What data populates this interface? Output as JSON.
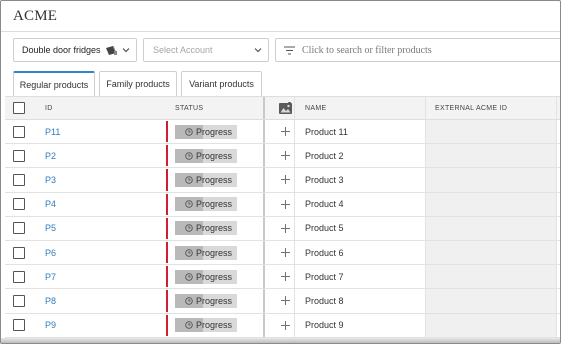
{
  "app": {
    "title": "ACME"
  },
  "toolbar": {
    "catalog_label": "Double door fridges",
    "account_placeholder": "Select Account",
    "search_placeholder": "Click to search or filter products"
  },
  "tabs": [
    {
      "label": "Regular products",
      "active": true
    },
    {
      "label": "Family products",
      "active": false
    },
    {
      "label": "Variant products",
      "active": false
    }
  ],
  "table": {
    "columns": {
      "id": "ID",
      "status": "STATUS",
      "name": "NAME",
      "external_id": "EXTERNAL ACME ID"
    },
    "rows": [
      {
        "id": "P11",
        "status": "Progress",
        "name": "Product 11",
        "external_id": ""
      },
      {
        "id": "P2",
        "status": "Progress",
        "name": "Product 2",
        "external_id": ""
      },
      {
        "id": "P3",
        "status": "Progress",
        "name": "Product 3",
        "external_id": ""
      },
      {
        "id": "P4",
        "status": "Progress",
        "name": "Product 4",
        "external_id": ""
      },
      {
        "id": "P5",
        "status": "Progress",
        "name": "Product 5",
        "external_id": ""
      },
      {
        "id": "P6",
        "status": "Progress",
        "name": "Product 6",
        "external_id": ""
      },
      {
        "id": "P7",
        "status": "Progress",
        "name": "Product 7",
        "external_id": ""
      },
      {
        "id": "P8",
        "status": "Progress",
        "name": "Product 8",
        "external_id": ""
      },
      {
        "id": "P9",
        "status": "Progress",
        "name": "Product 9",
        "external_id": ""
      }
    ]
  },
  "colors": {
    "accent": "#2e86c8",
    "link": "#2e7cc2",
    "status_bar": "#d01f30"
  }
}
